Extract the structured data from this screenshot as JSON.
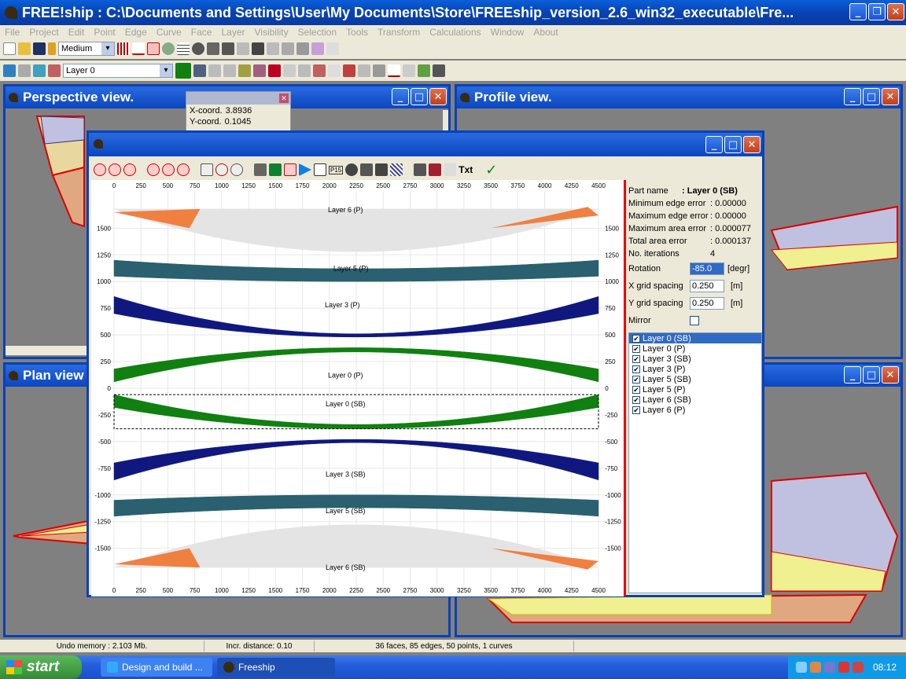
{
  "app": {
    "title": "FREE!ship     : C:\\Documents and Settings\\User\\My Documents\\Store\\FREEship_version_2.6_win32_executable\\Fre..."
  },
  "menu": [
    "File",
    "Project",
    "Edit",
    "Point",
    "Edge",
    "Curve",
    "Face",
    "Layer",
    "Visibility",
    "Selection",
    "Tools",
    "Transform",
    "Calculations",
    "Window",
    "About"
  ],
  "toolbar": {
    "precision": "Medium",
    "layer": "Layer 0"
  },
  "panes": {
    "perspective": "Perspective view.",
    "profile": "Profile view.",
    "plan": "Plan view"
  },
  "coords": {
    "x_label": "X-coord.",
    "x_value": "3.8936",
    "y_label": "Y-coord.",
    "y_value": "0.1045"
  },
  "dialog": {
    "tool_txt": "Txt",
    "tool_p15": "P15",
    "canvas_labels": [
      "Layer 6 (P)",
      "Layer 5 (P)",
      "Layer 3 (P)",
      "Layer 0 (P)",
      "Layer 0 (SB)",
      "Layer 3 (SB)",
      "Layer 5 (SB)",
      "Layer 6 (SB)"
    ],
    "x_ticks": [
      "0",
      "250",
      "500",
      "750",
      "1000",
      "1250",
      "1500",
      "1750",
      "2000",
      "2250",
      "2500",
      "2750",
      "3000",
      "3250",
      "3500",
      "3750",
      "4000",
      "4250",
      "4500"
    ],
    "y_ticks": [
      "1500",
      "1250",
      "1000",
      "750",
      "500",
      "250",
      "0",
      "-250",
      "-500",
      "-750",
      "-1000",
      "-1250",
      "-1500"
    ],
    "props": {
      "part_name_label": "Part name",
      "part_name_value": ": Layer 0 (SB)",
      "min_edge_label": "Minimum edge error",
      "min_edge_value": ": 0.00000",
      "max_edge_label": "Maximum edge error",
      "max_edge_value": ": 0.00000",
      "max_area_label": "Maximum area error",
      "max_area_value": ": 0.000077",
      "total_area_label": "Total area error",
      "total_area_value": ": 0.000137",
      "iterations_label": "No. iterations",
      "iterations_value": "4",
      "rotation_label": "Rotation",
      "rotation_value": "-85.0",
      "rotation_unit": "[degr]",
      "xgrid_label": "X grid spacing",
      "xgrid_value": "0.250",
      "xgrid_unit": "[m]",
      "ygrid_label": "Y grid spacing",
      "ygrid_value": "0.250",
      "ygrid_unit": "[m]",
      "mirror_label": "Mirror"
    },
    "layers": [
      "Layer 0 (SB)",
      "Layer 0 (P)",
      "Layer 3 (SB)",
      "Layer 3 (P)",
      "Layer 5 (SB)",
      "Layer 5 (P)",
      "Layer 6 (SB)",
      "Layer 6 (P)"
    ]
  },
  "status": {
    "undo": "Undo memory : 2.103 Mb.",
    "incr": "Incr. distance: 0.10",
    "stats": "36 faces, 85 edges, 50 points, 1 curves"
  },
  "taskbar": {
    "start": "start",
    "task1": "Design and build ...",
    "task2": "Freeship",
    "clock": "08:12"
  }
}
